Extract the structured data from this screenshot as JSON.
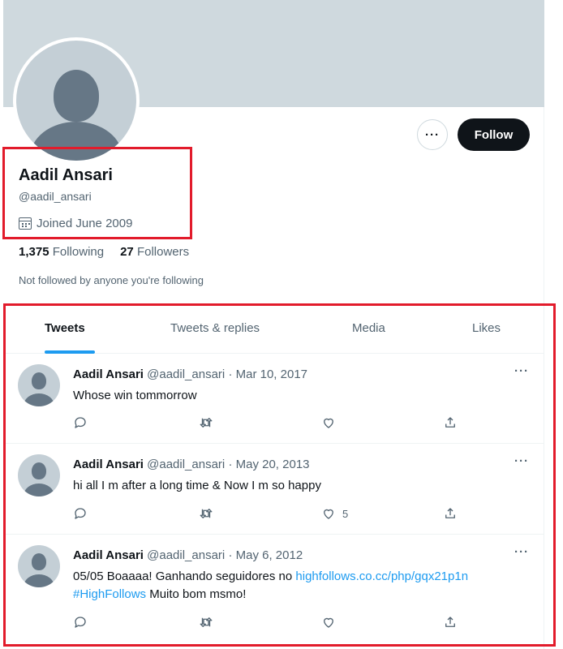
{
  "profile": {
    "name": "Aadil Ansari",
    "handle": "@aadil_ansari",
    "joined": "Joined June 2009",
    "following_count": "1,375",
    "following_label": "Following",
    "followers_count": "27",
    "followers_label": "Followers",
    "not_followed": "Not followed by anyone you're following",
    "more_label": "···",
    "follow_label": "Follow"
  },
  "tabs": [
    {
      "label": "Tweets"
    },
    {
      "label": "Tweets & replies"
    },
    {
      "label": "Media"
    },
    {
      "label": "Likes"
    }
  ],
  "tweets": [
    {
      "author": "Aadil Ansari",
      "handle": "@aadil_ansari",
      "sep": "·",
      "date": "Mar 10, 2017",
      "text": "Whose win tommorrow",
      "likes": ""
    },
    {
      "author": "Aadil Ansari",
      "handle": "@aadil_ansari",
      "sep": "·",
      "date": "May 20, 2013",
      "text": "hi all I m after a long time & Now I m so happy",
      "likes": "5"
    },
    {
      "author": "Aadil Ansari",
      "handle": "@aadil_ansari",
      "sep": "·",
      "date": "May 6, 2012",
      "text_before": "05/05 Boaaaa! Ganhando seguidores no ",
      "link": "highfollows.co.cc/php/gqx21p1n",
      "hashtag": "#HighFollows",
      "text_after": " Muito bom msmo!",
      "likes": ""
    }
  ],
  "tweet_more_label": "···",
  "colors": {
    "accent": "#1d9bf0",
    "highlight_box": "#e21b2b",
    "banner": "#cfd9de",
    "follow_button": "#0f1419"
  },
  "icons": [
    "calendar-icon",
    "reply-icon",
    "retweet-icon",
    "like-icon",
    "share-icon",
    "more-icon"
  ]
}
